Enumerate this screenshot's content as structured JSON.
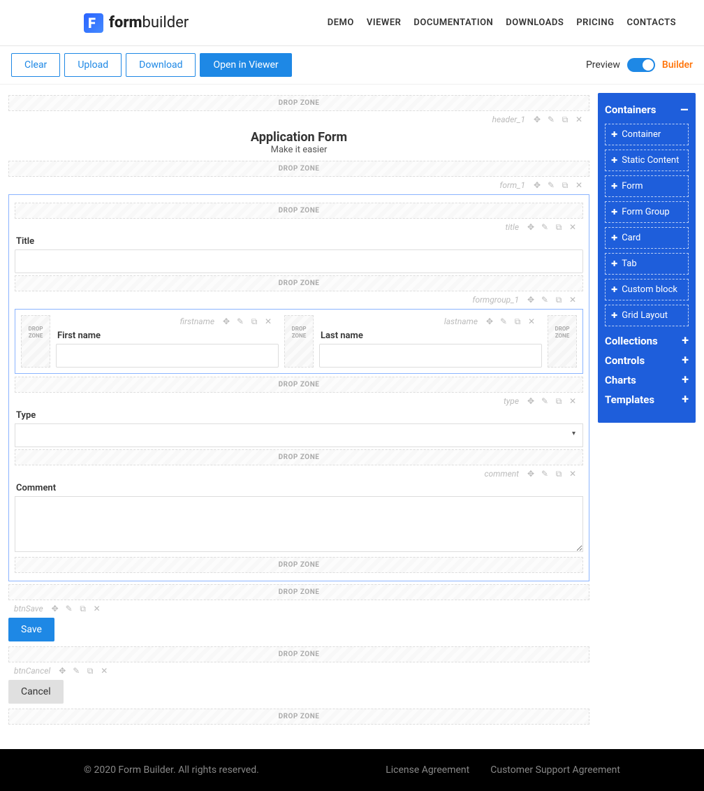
{
  "brand": {
    "name_bold": "form",
    "name_light": "builder"
  },
  "nav": [
    "DEMO",
    "VIEWER",
    "DOCUMENTATION",
    "DOWNLOADS",
    "PRICING",
    "CONTACTS"
  ],
  "toolbar": {
    "clear": "Clear",
    "upload": "Upload",
    "download": "Download",
    "open_viewer": "Open in Viewer",
    "preview": "Preview",
    "builder": "Builder"
  },
  "dropzone_label": "DROP ZONE",
  "vdrop_label": "DROP ZONE",
  "elements": {
    "header": {
      "id": "header_1",
      "title": "Application Form",
      "subtitle": "Make it easier"
    },
    "form": {
      "id": "form_1"
    },
    "title_field": {
      "id": "title",
      "label": "Title"
    },
    "formgroup": {
      "id": "formgroup_1",
      "firstname": {
        "id": "firstname",
        "label": "First name"
      },
      "lastname": {
        "id": "lastname",
        "label": "Last name"
      }
    },
    "type_field": {
      "id": "type",
      "label": "Type"
    },
    "comment_field": {
      "id": "comment",
      "label": "Comment"
    },
    "btn_save": {
      "id": "btnSave",
      "label": "Save"
    },
    "btn_cancel": {
      "id": "btnCancel",
      "label": "Cancel"
    }
  },
  "sidebar": {
    "containers": {
      "title": "Containers",
      "expanded": true,
      "items": [
        "Container",
        "Static Content",
        "Form",
        "Form Group",
        "Card",
        "Tab",
        "Custom block",
        "Grid Layout"
      ]
    },
    "sections": [
      "Collections",
      "Controls",
      "Charts",
      "Templates"
    ]
  },
  "footer": {
    "copyright": "© 2020 Form Builder. All rights reserved.",
    "license": "License Agreement",
    "support": "Customer Support Agreement"
  }
}
